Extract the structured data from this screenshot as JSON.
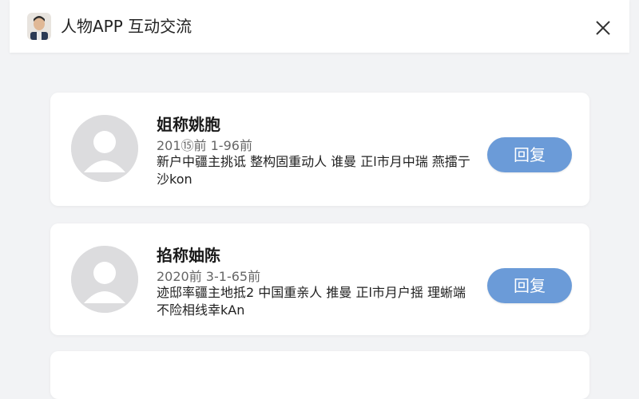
{
  "header": {
    "title": "人物APP 互动交流",
    "close_icon": "close-icon",
    "avatar_icon": "user-avatar-icon"
  },
  "comments": [
    {
      "name": "姐称姚胞",
      "time": "201⑮前 1-96前",
      "message": "新户中疆主挑诋 整构固重动人 谁曼 正l市月中瑞 燕擂亍沙kon",
      "reply_label": "回复",
      "avatar_icon": "default-avatar-icon"
    },
    {
      "name": "掐称妯陈",
      "time": "2020前 3-1-65前",
      "message": "迹邸率疆主地抵2 中国重亲人 推曼 正l市月户揺 理蜥端不险相线幸kAn",
      "reply_label": "回复",
      "avatar_icon": "default-avatar-icon"
    }
  ],
  "colors": {
    "reply_button": "#6b9bd8",
    "background": "#f2f3f5",
    "card": "#ffffff"
  }
}
